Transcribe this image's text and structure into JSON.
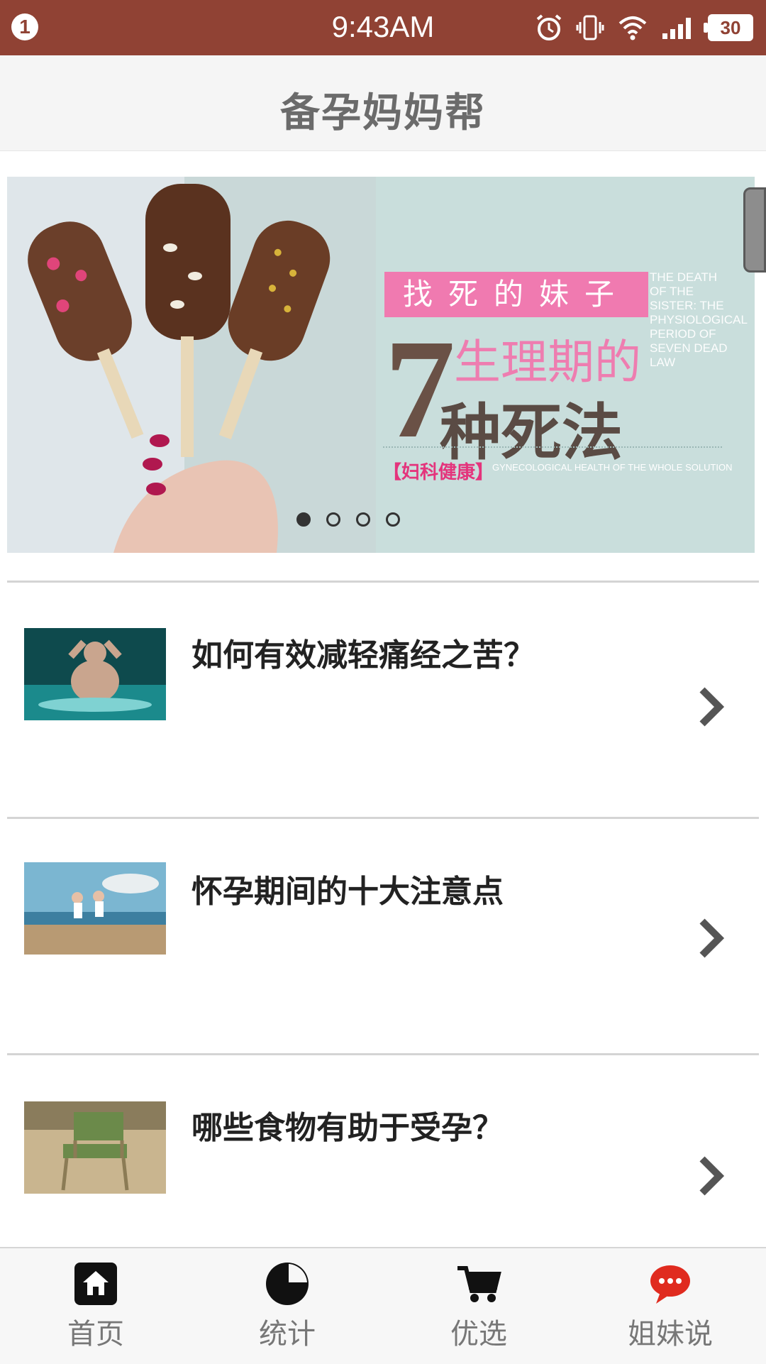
{
  "status_bar": {
    "notification_count": "1",
    "time": "9:43AM",
    "battery": "30"
  },
  "header": {
    "title": "备孕妈妈帮"
  },
  "banner": {
    "tag": "找死的妹子",
    "big_number": "7",
    "line1": "生理期的",
    "line2": "种死法",
    "english": "THE DEATH OF THE SISTER: THE PHYSIOLOGICAL PERIOD OF SEVEN DEAD LAW",
    "category": "【妇科健康】",
    "category_en": "GYNECOLOGICAL HEALTH OF THE WHOLE SOLUTION",
    "pages": 4,
    "active_page": 1
  },
  "articles": [
    {
      "title": "如何有效减轻痛经之苦？",
      "thumbnail": "man-in-water-photo"
    },
    {
      "title": "怀孕期间的十大注意点",
      "thumbnail": "couple-jumping-beach-photo"
    },
    {
      "title": "哪些食物有助于受孕？",
      "thumbnail": "school-chair-photo"
    }
  ],
  "bottom_nav": [
    {
      "label": "首页",
      "icon": "home-icon",
      "active": true
    },
    {
      "label": "统计",
      "icon": "pie-chart-icon"
    },
    {
      "label": "优选",
      "icon": "cart-icon"
    },
    {
      "label": "姐妹说",
      "icon": "chat-bubble-icon"
    }
  ],
  "colors": {
    "status_bar": "#904234",
    "chat_icon": "#e02b1f",
    "tag_pink": "#f07ab0"
  }
}
